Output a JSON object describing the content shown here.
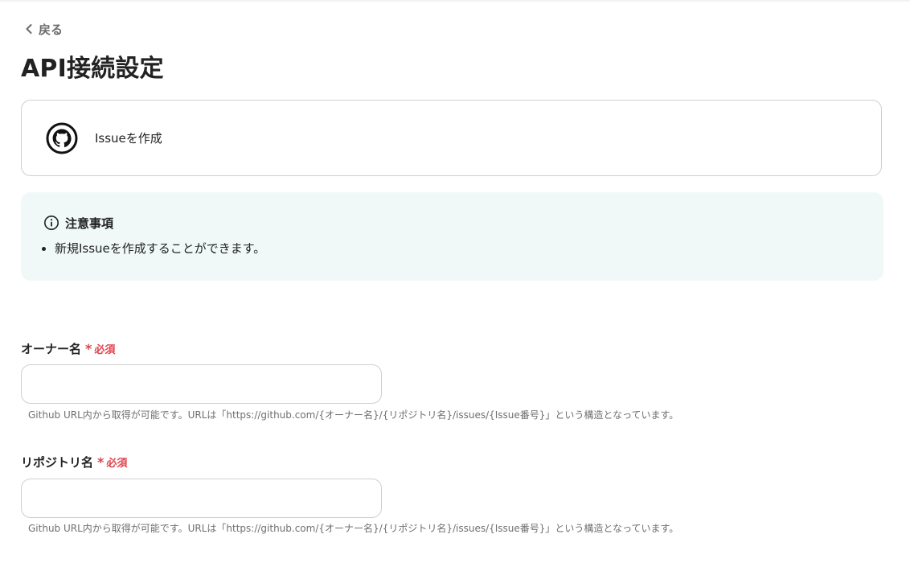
{
  "back": {
    "label": "戻る"
  },
  "page": {
    "title": "API接続設定"
  },
  "action": {
    "name": "Issueを作成"
  },
  "notice": {
    "title": "注意事項",
    "items": [
      "新規Issueを作成することができます。"
    ]
  },
  "fields": [
    {
      "label": "オーナー名",
      "required_mark": "*",
      "required_text": "必須",
      "value": "",
      "placeholder": "",
      "help": "Github URL内から取得が可能です。URLは「https://github.com/{オーナー名}/{リポジトリ名}/issues/{Issue番号}」という構造となっています。"
    },
    {
      "label": "リポジトリ名",
      "required_mark": "*",
      "required_text": "必須",
      "value": "",
      "placeholder": "",
      "help": "Github URL内から取得が可能です。URLは「https://github.com/{オーナー名}/{リポジトリ名}/issues/{Issue番号}」という構造となっています。"
    }
  ],
  "colors": {
    "required": "#e0434d",
    "notice_bg": "#f1f9f8",
    "border": "#cfcfcf",
    "help_text": "#6f6f6f"
  },
  "icons": {
    "back": "chevron-left-icon",
    "app": "github-icon",
    "notice": "info-icon"
  }
}
